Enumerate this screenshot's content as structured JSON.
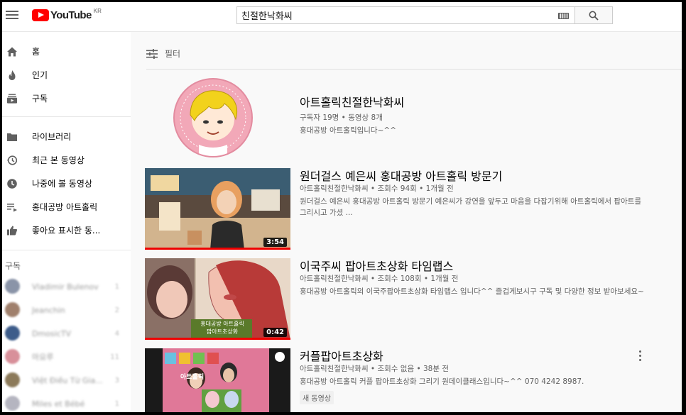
{
  "masthead": {
    "logo_text": "YouTube",
    "region": "KR",
    "search_value": "친절한낙화씨"
  },
  "sidebar": {
    "primary": [
      {
        "label": "홈",
        "icon": "home-icon"
      },
      {
        "label": "인기",
        "icon": "flame-icon"
      },
      {
        "label": "구독",
        "icon": "subscriptions-icon"
      }
    ],
    "library": [
      {
        "label": "라이브러리",
        "icon": "folder-icon"
      },
      {
        "label": "최근 본 동영상",
        "icon": "history-icon"
      },
      {
        "label": "나중에 볼 동영상",
        "icon": "clock-icon"
      },
      {
        "label": "홍대공방 아트홀릭",
        "icon": "playlist-icon"
      },
      {
        "label": "좋아요 표시한 동...",
        "icon": "thumbs-up-icon"
      }
    ],
    "subscriptions_title": "구독",
    "subscriptions": [
      {
        "name": "Vladimir Bulenov",
        "count": "1"
      },
      {
        "name": "Jeanchin",
        "count": "2"
      },
      {
        "name": "DmosicTV",
        "count": "4"
      },
      {
        "name": "마요루",
        "count": "11"
      },
      {
        "name": "Việt Điều Từ Gia...",
        "count": "3"
      },
      {
        "name": "Miles et Bébé",
        "count": "1"
      }
    ]
  },
  "filter": {
    "label": "필터"
  },
  "channel": {
    "name": "아트홀릭친절한낙화씨",
    "meta": "구독자 19명 • 동영상 8개",
    "description": "홍대공방 아트홀릭입니다~^^"
  },
  "videos": [
    {
      "title": "원더걸스 예은씨 홍대공방 아트홀릭 방문기",
      "meta": "아트홀릭친절한낙화씨 • 조회수 94회 • 1개월 전",
      "description": "원더걸스 예은씨 홍대공방 아트홀릭 방문기 예은씨가 강연을 앞두고 마음을 다잡기위해 아트홀릭에서 팝아트를 그리시고 가셨 ...",
      "duration": "3:54"
    },
    {
      "title": "이국주씨 팝아트초상화 타임랩스",
      "meta": "아트홀릭친절한낙화씨 • 조회수 108회 • 1개월 전",
      "description": "홍대공방 아트홀릭의 이국주팝아트초상화 타임랩스 입니다^^ 즐겁게보시구 구독 및 다양한 정보 받아보세요~",
      "duration": "0:42",
      "thumb_caption_1": "홍대공방 아트홀릭",
      "thumb_caption_2": "팝아트초상화"
    },
    {
      "title": "커플팝아트초상화",
      "meta": "아트홀릭친절한낙화씨 • 조회수 없음 • 38분 전",
      "description": "홍대공방 아트홀릭 커플 팝아트초상화 그리기 원데이클래스입니다~^^ 070 4242 8987.",
      "badge": "새 동영상",
      "thumb_caption": "아트홀릭"
    }
  ]
}
